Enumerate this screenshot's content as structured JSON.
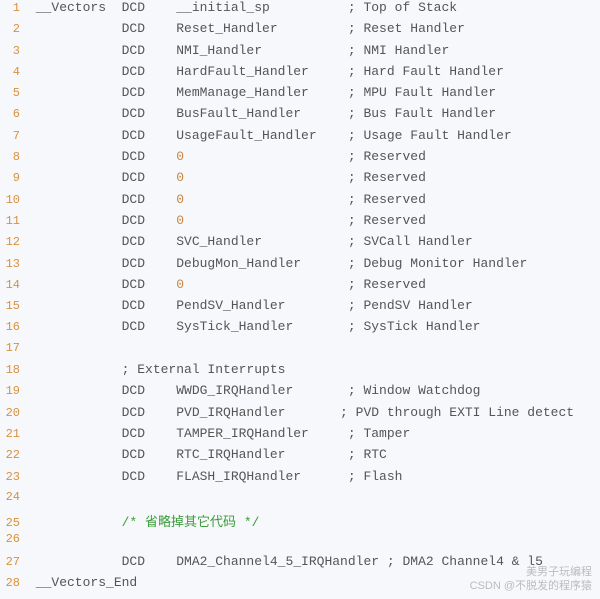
{
  "code": {
    "lines": [
      {
        "ln": "1",
        "segs": [
          {
            "t": "txt",
            "v": " __Vectors  DCD    __initial_sp          ; Top of Stack"
          }
        ]
      },
      {
        "ln": "2",
        "segs": [
          {
            "t": "txt",
            "v": "            DCD    Reset_Handler         ; Reset Handler"
          }
        ]
      },
      {
        "ln": "3",
        "segs": [
          {
            "t": "txt",
            "v": "            DCD    NMI_Handler           ; NMI Handler"
          }
        ]
      },
      {
        "ln": "4",
        "segs": [
          {
            "t": "txt",
            "v": "            DCD    HardFault_Handler     ; Hard Fault Handler"
          }
        ]
      },
      {
        "ln": "5",
        "segs": [
          {
            "t": "txt",
            "v": "            DCD    MemManage_Handler     ; MPU Fault Handler"
          }
        ]
      },
      {
        "ln": "6",
        "segs": [
          {
            "t": "txt",
            "v": "            DCD    BusFault_Handler      ; Bus Fault Handler"
          }
        ]
      },
      {
        "ln": "7",
        "segs": [
          {
            "t": "txt",
            "v": "            DCD    UsageFault_Handler    ; Usage Fault Handler"
          }
        ]
      },
      {
        "ln": "8",
        "segs": [
          {
            "t": "txt",
            "v": "            DCD    "
          },
          {
            "t": "num",
            "v": "0"
          },
          {
            "t": "txt",
            "v": "                     ; Reserved"
          }
        ]
      },
      {
        "ln": "9",
        "segs": [
          {
            "t": "txt",
            "v": "            DCD    "
          },
          {
            "t": "num",
            "v": "0"
          },
          {
            "t": "txt",
            "v": "                     ; Reserved"
          }
        ]
      },
      {
        "ln": "10",
        "segs": [
          {
            "t": "txt",
            "v": "            DCD    "
          },
          {
            "t": "num",
            "v": "0"
          },
          {
            "t": "txt",
            "v": "                     ; Reserved"
          }
        ]
      },
      {
        "ln": "11",
        "segs": [
          {
            "t": "txt",
            "v": "            DCD    "
          },
          {
            "t": "num",
            "v": "0"
          },
          {
            "t": "txt",
            "v": "                     ; Reserved"
          }
        ]
      },
      {
        "ln": "12",
        "segs": [
          {
            "t": "txt",
            "v": "            DCD    SVC_Handler           ; SVCall Handler"
          }
        ]
      },
      {
        "ln": "13",
        "segs": [
          {
            "t": "txt",
            "v": "            DCD    DebugMon_Handler      ; Debug Monitor Handler"
          }
        ]
      },
      {
        "ln": "14",
        "segs": [
          {
            "t": "txt",
            "v": "            DCD    "
          },
          {
            "t": "num",
            "v": "0"
          },
          {
            "t": "txt",
            "v": "                     ; Reserved"
          }
        ]
      },
      {
        "ln": "15",
        "segs": [
          {
            "t": "txt",
            "v": "            DCD    PendSV_Handler        ; PendSV Handler"
          }
        ]
      },
      {
        "ln": "16",
        "segs": [
          {
            "t": "txt",
            "v": "            DCD    SysTick_Handler       ; SysTick Handler"
          }
        ]
      },
      {
        "ln": "17",
        "segs": [
          {
            "t": "txt",
            "v": ""
          }
        ]
      },
      {
        "ln": "18",
        "segs": [
          {
            "t": "txt",
            "v": "            ; External Interrupts"
          }
        ]
      },
      {
        "ln": "19",
        "segs": [
          {
            "t": "txt",
            "v": "            DCD    WWDG_IRQHandler       ; Window Watchdog"
          }
        ]
      },
      {
        "ln": "20",
        "segs": [
          {
            "t": "txt",
            "v": "            DCD    PVD_IRQHandler       ; PVD through EXTI Line detect"
          }
        ]
      },
      {
        "ln": "21",
        "segs": [
          {
            "t": "txt",
            "v": "            DCD    TAMPER_IRQHandler     ; Tamper"
          }
        ]
      },
      {
        "ln": "22",
        "segs": [
          {
            "t": "txt",
            "v": "            DCD    RTC_IRQHandler        ; RTC"
          }
        ]
      },
      {
        "ln": "23",
        "segs": [
          {
            "t": "txt",
            "v": "            DCD    FLASH_IRQHandler      ; Flash"
          }
        ]
      },
      {
        "ln": "24",
        "segs": [
          {
            "t": "txt",
            "v": ""
          }
        ]
      },
      {
        "ln": "25",
        "segs": [
          {
            "t": "txt",
            "v": "            "
          },
          {
            "t": "comment-green",
            "v": "/* 省略掉其它代码 */"
          }
        ]
      },
      {
        "ln": "26",
        "segs": [
          {
            "t": "txt",
            "v": ""
          }
        ]
      },
      {
        "ln": "27",
        "segs": [
          {
            "t": "txt",
            "v": "            DCD    DMA2_Channel4_5_IRQHandler ; DMA2 Channel4 & l5"
          }
        ]
      },
      {
        "ln": "28",
        "segs": [
          {
            "t": "txt",
            "v": " __Vectors_End"
          }
        ]
      }
    ]
  },
  "watermark": {
    "line1": "美男子玩编程",
    "line2": "CSDN @不脱发的程序猿"
  }
}
